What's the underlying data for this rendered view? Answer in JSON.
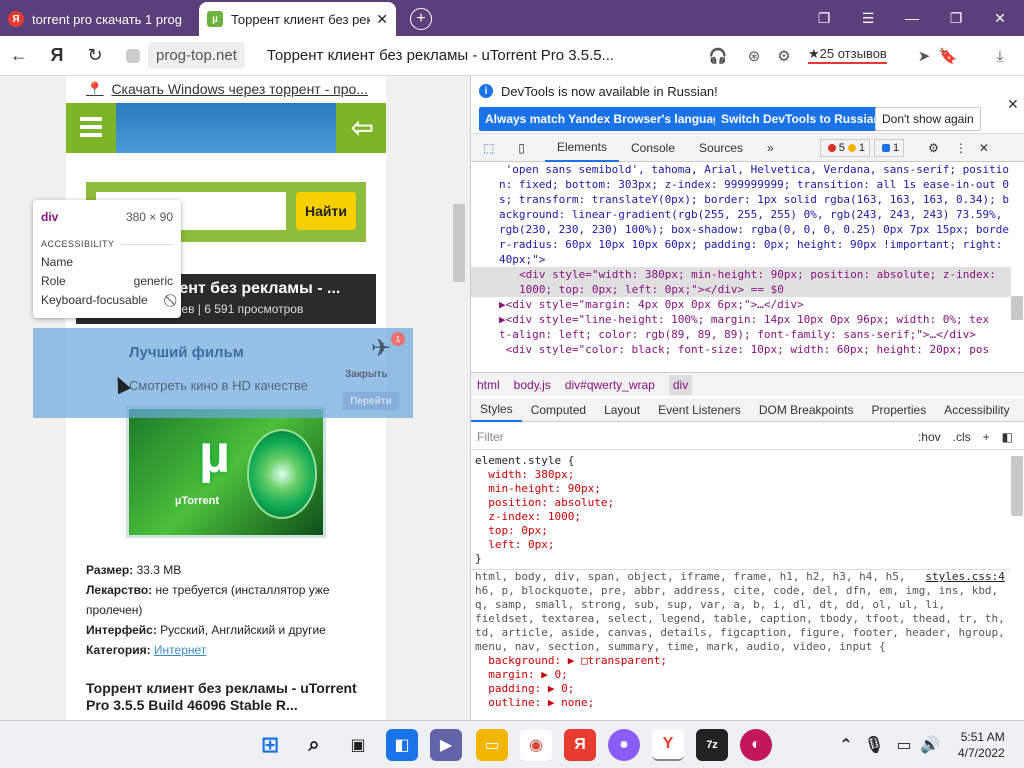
{
  "browser": {
    "tabs": [
      {
        "title": "torrent pro скачать 1 prog",
        "favicon": "yandex-icon",
        "favicon_color": "#e63b2e"
      },
      {
        "title": "Торрент клиент без рекл",
        "favicon": "utorrent-icon",
        "favicon_color": "#6cb33e",
        "close": "✕"
      }
    ],
    "new_tab": "+",
    "domain": "prog-top.net",
    "page_title": "Торрент клиент без рекламы - uTorrent Pro 3.5.5...",
    "reviews": "★25 отзывов"
  },
  "page": {
    "top_link": "Скачать Windows через торрент - про...",
    "search_placeholder": "...амм...",
    "search_button": "Найти",
    "article_title": "...лиент без рекламы - ...",
    "article_meta": "...тариев | 6 591 просмотров",
    "product_logo": "µ",
    "product_label": "µTorrent",
    "meta": {
      "size_label": "Размер:",
      "size_value": "33.3 MB",
      "med_label": "Лекарство:",
      "med_value": "не требуется (инсталлятор уже пролечен)",
      "iface_label": "Интерфейс:",
      "iface_value": "Русский, Английский и другие",
      "cat_label": "Категория:",
      "cat_value": "Интернет"
    },
    "desc": "Торрент клиент без рекламы - uTorrent Pro 3.5.5 Build 46096 Stable R..."
  },
  "tooltip": {
    "tag": "div",
    "dims": "380 × 90",
    "section": "ACCESSIBILITY",
    "rows": [
      {
        "k": "Name",
        "v": ""
      },
      {
        "k": "Role",
        "v": "generic"
      },
      {
        "k": "Keyboard-focusable",
        "v": "⃠"
      }
    ]
  },
  "ad": {
    "title": "Лучший фильм",
    "subtitle": "Смотреть кино в HD качестве",
    "close": "Закрыть",
    "go": "Перейти",
    "badge": "1"
  },
  "devtools": {
    "info_msg": "DevTools is now available in Russian!",
    "btn_match": "Always match Yandex Browser's language",
    "btn_switch": "Switch DevTools to Russian",
    "btn_dont": "Don't show again",
    "tabs": [
      "Elements",
      "Console",
      "Sources",
      "»"
    ],
    "errors": "5",
    "warnings": "1",
    "messages": "1",
    "code_lines": [
      " 'open sans semibold', tahoma, Arial, Helvetica, Verdana, sans-serif; positio",
      "n: fixed; bottom: 303px; z-index: 999999999; transition: all 1s ease-in-out 0",
      "s; transform: translateY(0px); border: 1px solid rgba(163, 163, 163, 0.34); b",
      "ackground: linear-gradient(rgb(255, 255, 255) 0%, rgb(243, 243, 243) 73.59%,",
      "rgb(230, 230, 230) 100%); box-shadow: rgba(0, 0, 0, 0.25) 0px 7px 15px; borde",
      "r-radius: 60px 10px 10px 60px; padding: 0px; height: 90px !important; right:",
      "40px;\">"
    ],
    "selected_line_1": "<div style=\"width: 380px; min-height: 90px; position: absolute; z-index:",
    "selected_line_2": "1000; top: 0px; left: 0px;\"></div> == $0",
    "child_lines": [
      "▶<div style=\"margin: 4px 0px 0px 6px;\">…</div>",
      "▶<div style=\"line-height: 100%; margin: 14px 10px 0px 96px; width: 0%; tex",
      "t-align: left; color: rgb(89, 89, 89); font-family: sans-serif;\">…</div>",
      " <div style=\"color: black; font-size: 10px; width: 60px; height: 20px; pos"
    ],
    "breadcrumbs": [
      "html",
      "body.js",
      "div#qwerty_wrap",
      "div"
    ],
    "style_tabs": [
      "Styles",
      "Computed",
      "Layout",
      "Event Listeners",
      "DOM Breakpoints",
      "Properties",
      "Accessibility"
    ],
    "filter_placeholder": "Filter",
    "hov": ":hov",
    "cls": ".cls",
    "element_style_lines": [
      "element.style {",
      "  width: 380px;",
      "  min-height: 90px;",
      "  position: absolute;",
      "  z-index: 1000;",
      "  top: 0px;",
      "  left: 0px;",
      "}"
    ],
    "rule_selector_lines": [
      "html, body, div, span, object, iframe, frame, h1, h2, h3, h4, h5,",
      "h6, p, blockquote, pre, abbr, address, cite, code, del, dfn, em, img, ins, kbd,",
      "q, samp, small, strong, sub, sup, var, a, b, i, dl, dt, dd, ol, ul, li,",
      "fieldset, textarea, select, legend, table, caption, tbody, tfoot, thead, tr, th,",
      "td, article, aside, canvas, details, figcaption, figure, footer, header, hgroup,",
      "menu, nav, section, summary, time, mark, audio, video, input {"
    ],
    "rule_file": "styles.css:4",
    "rule_props": [
      "  background: ▶ □transparent;",
      "  margin: ▶ 0;",
      "  padding: ▶ 0;",
      "  outline: ▶ none;"
    ]
  },
  "taskbar": {
    "time": "5:51 AM",
    "date": "4/7/2022"
  }
}
